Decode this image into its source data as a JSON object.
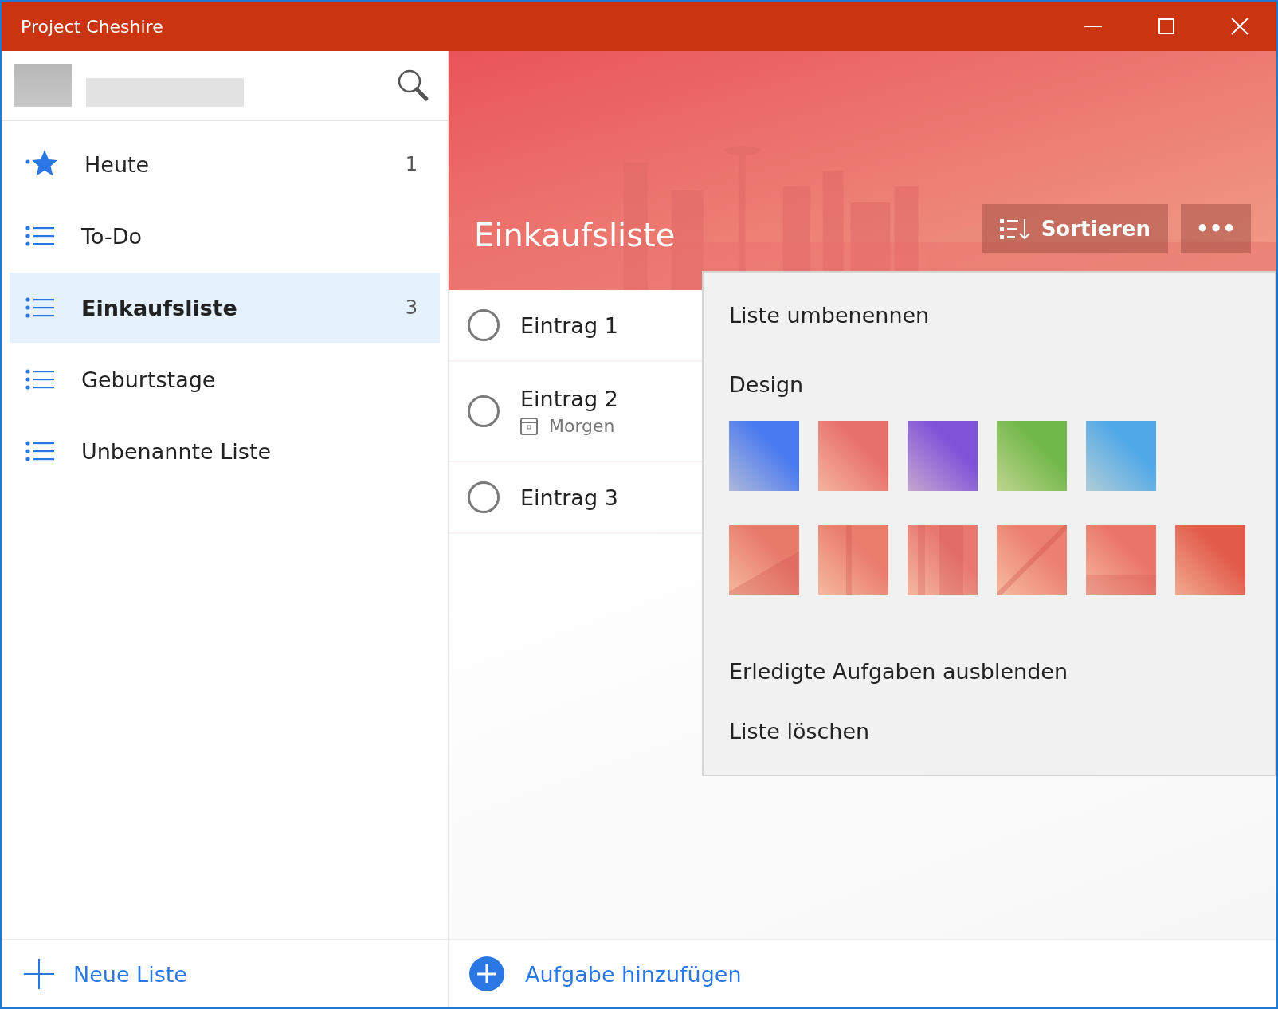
{
  "window": {
    "title": "Project Cheshire"
  },
  "sidebar": {
    "items": [
      {
        "label": "Heute",
        "count": "1",
        "kind": "star",
        "selected": false
      },
      {
        "label": "To-Do",
        "kind": "list",
        "selected": false
      },
      {
        "label": "Einkaufsliste",
        "count": "3",
        "kind": "list",
        "selected": true
      },
      {
        "label": "Geburtstage",
        "kind": "list",
        "selected": false
      },
      {
        "label": "Unbenannte Liste",
        "kind": "list",
        "selected": false
      }
    ],
    "new_list": "Neue Liste"
  },
  "list": {
    "title": "Einkaufsliste",
    "sort_button": "Sortieren",
    "more_button": "•••",
    "tasks": [
      {
        "title": "Eintrag 1",
        "checked": false
      },
      {
        "title": "Eintrag 2",
        "due": "Morgen",
        "checked": false
      },
      {
        "title": "Eintrag 3",
        "checked": false
      }
    ],
    "add_task": "Aufgabe hinzufügen"
  },
  "menu": {
    "rename": "Liste umbenennen",
    "design_label": "Design",
    "design_rows": [
      [
        {
          "kind": "gradient",
          "color": "#4a7af0"
        },
        {
          "kind": "gradient",
          "color": "#e8706a"
        },
        {
          "kind": "gradient",
          "color": "#8052d8"
        },
        {
          "kind": "gradient",
          "color": "#70b848"
        },
        {
          "kind": "gradient",
          "color": "#50a8e8"
        }
      ],
      [
        {
          "kind": "mountains",
          "color": "#e87a6a"
        },
        {
          "kind": "tower",
          "color": "#ea7c6c"
        },
        {
          "kind": "buildings",
          "color": "#e87870"
        },
        {
          "kind": "plane",
          "color": "#ec8070"
        },
        {
          "kind": "houses",
          "color": "#ea7468"
        },
        {
          "kind": "gradient",
          "color": "#e25a4a"
        }
      ]
    ],
    "hide_done": "Erledigte Aufgaben ausblenden",
    "delete": "Liste löschen"
  }
}
